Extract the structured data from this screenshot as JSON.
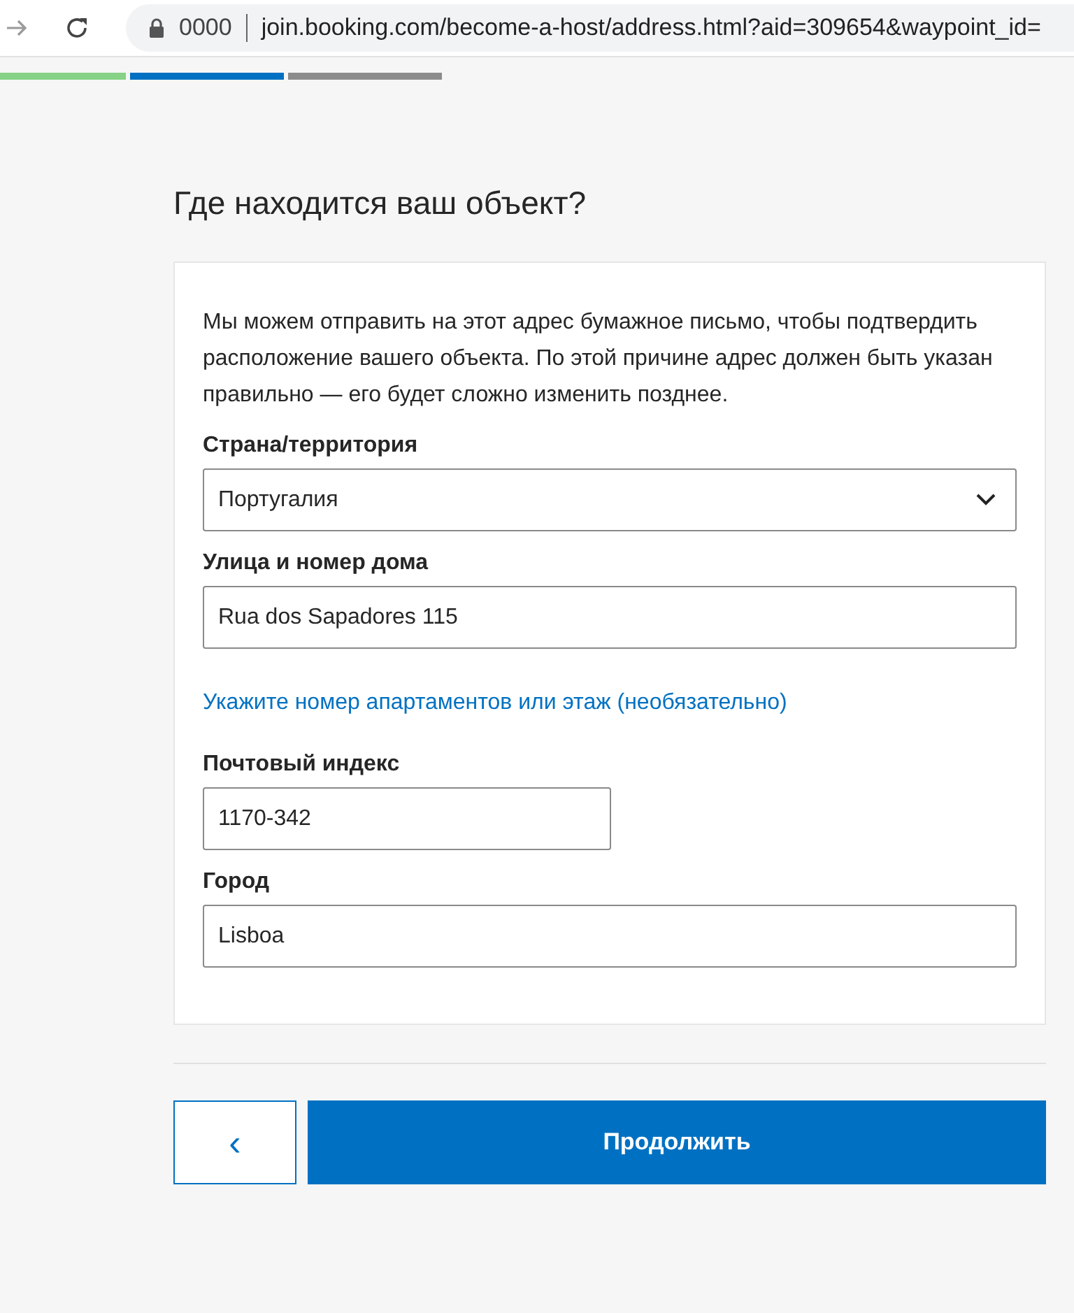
{
  "browser": {
    "security_text": "0000",
    "url": "join.booking.com/become-a-host/address.html?aid=309654&waypoint_id="
  },
  "progress_steps": [
    {
      "color": "#86d286"
    },
    {
      "color": "#0071c2"
    },
    {
      "color": "#8c8c8c"
    }
  ],
  "title": "Где находится ваш объект?",
  "intro": "Мы можем отправить на этот адрес бумажное письмо, чтобы подтвердить расположение вашего объекта. По этой причине адрес должен быть указан правильно — его будет сложно изменить позднее.",
  "fields": [
    {
      "kind": "select",
      "label": "Страна/территория",
      "value": "Португалия"
    },
    {
      "kind": "text",
      "label": "Улица и номер дома",
      "value": "Rua dos Sapadores 115"
    },
    {
      "kind": "link",
      "label": "Укажите номер апартаментов или этаж (необязательно)"
    },
    {
      "kind": "short",
      "label": "Почтовый индекс",
      "value": "1170-342"
    },
    {
      "kind": "text",
      "label": "Город",
      "value": "Lisboa"
    }
  ],
  "back_button": "‹",
  "continue_button": "Продолжить"
}
